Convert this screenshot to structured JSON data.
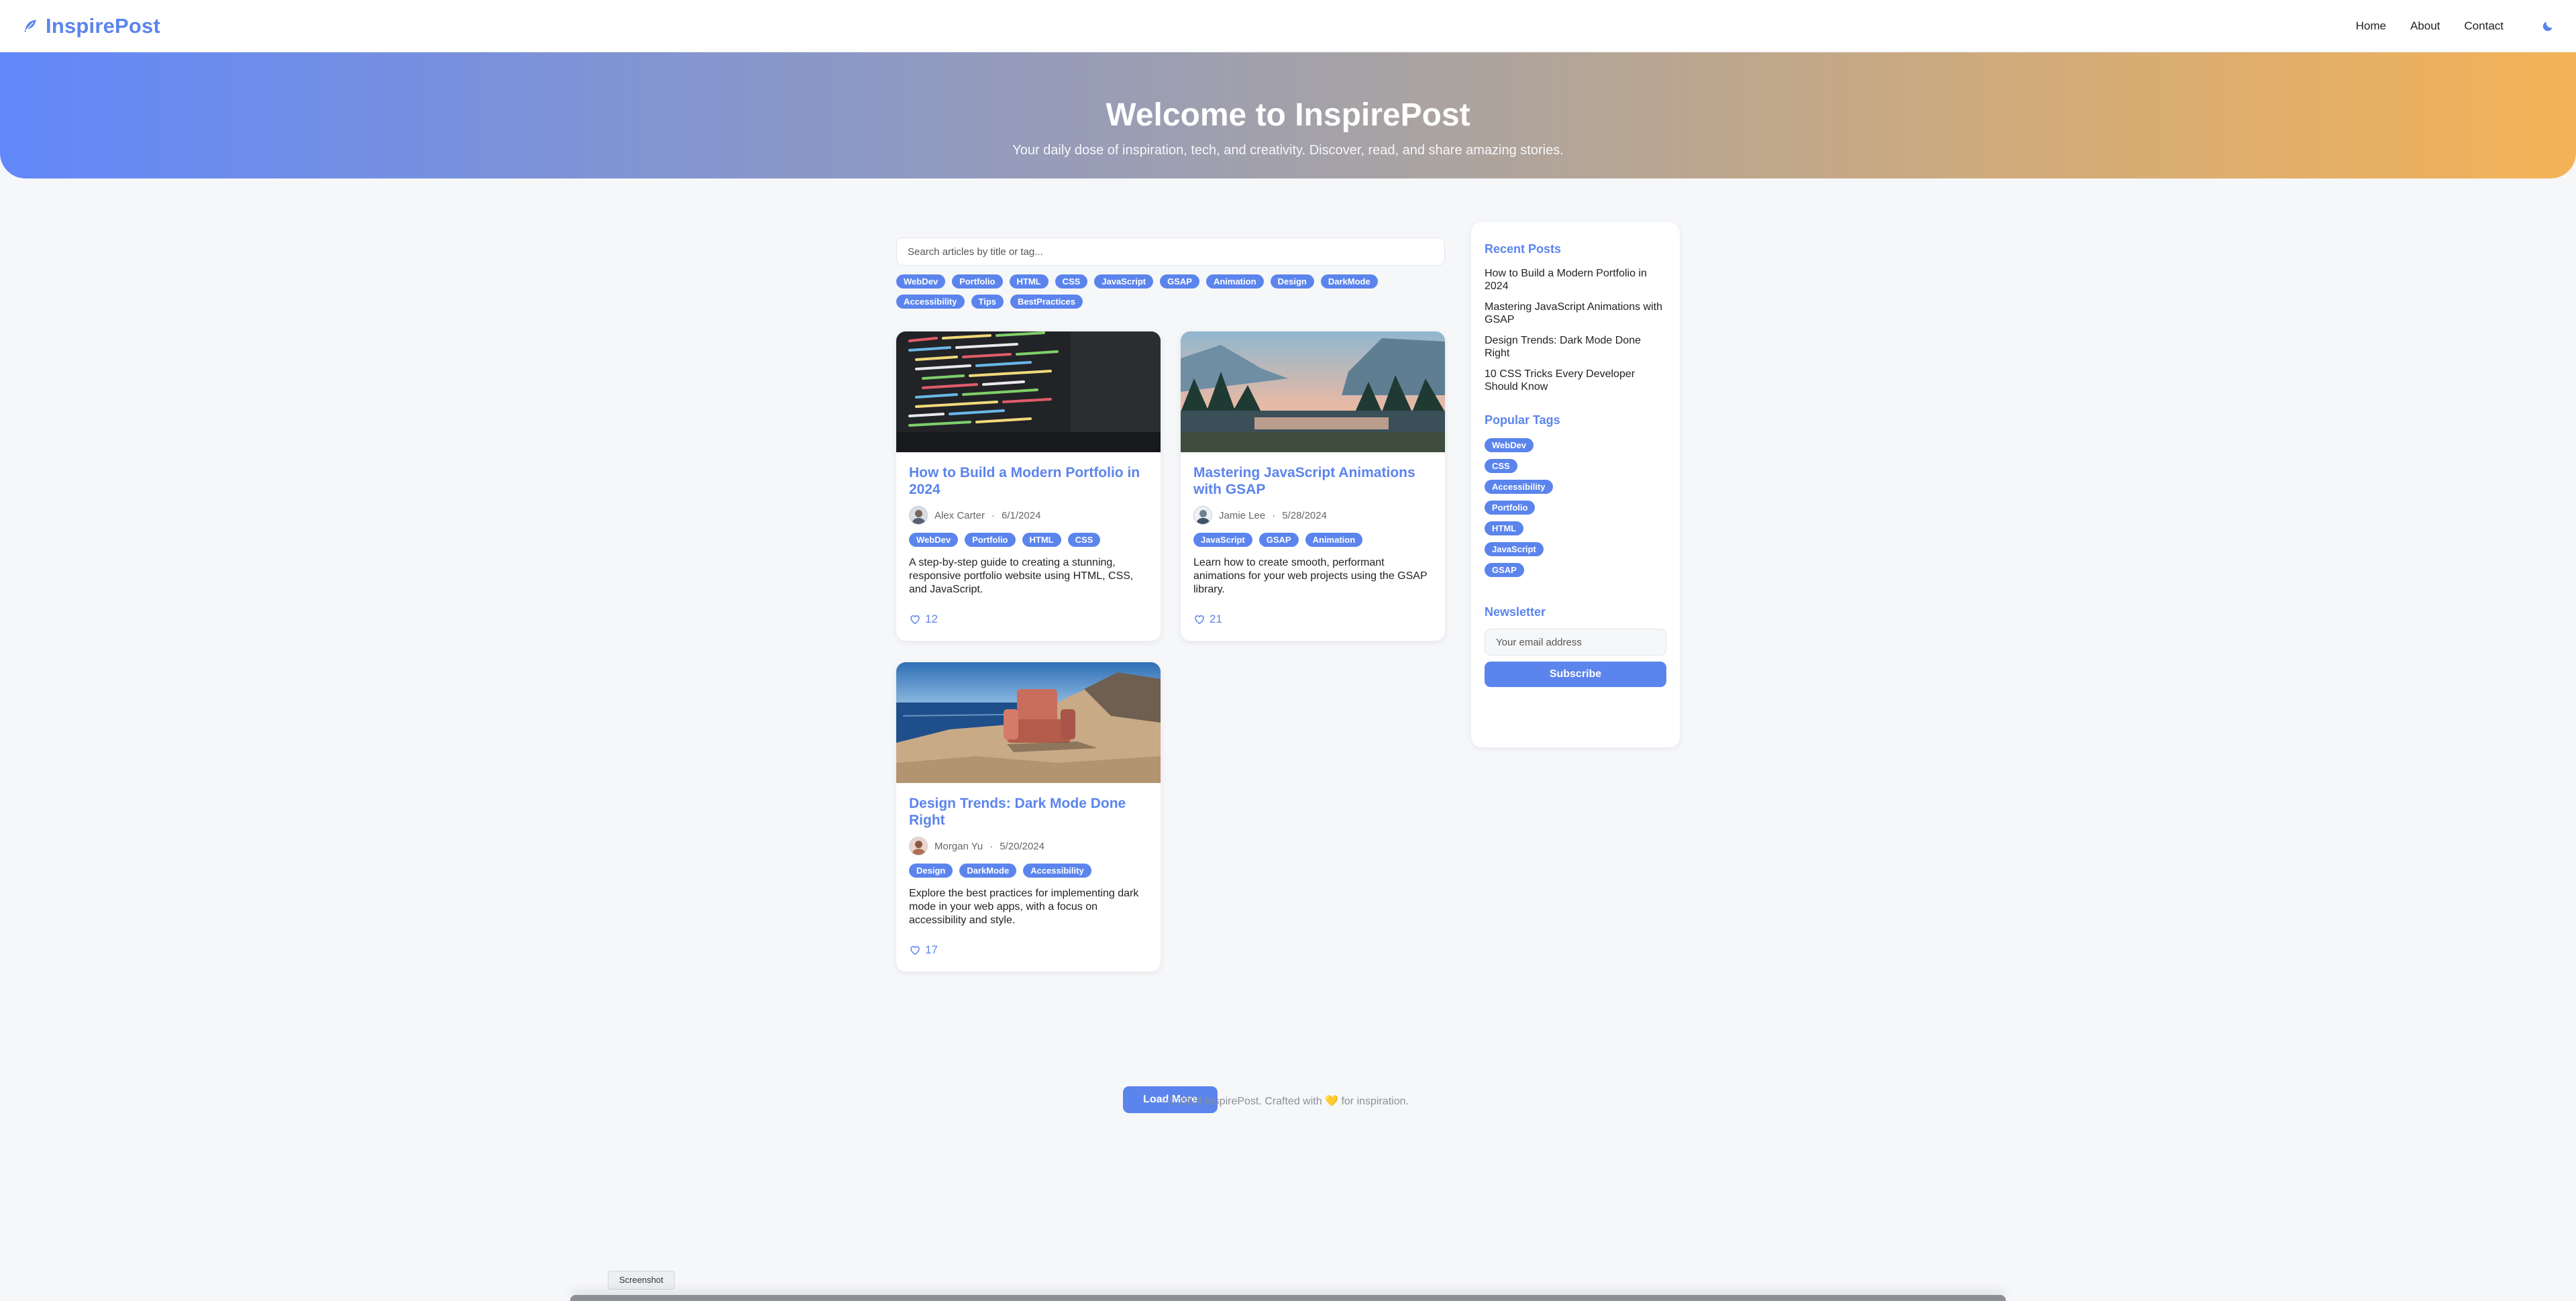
{
  "header": {
    "logo_text": "InspirePost",
    "nav": [
      "Home",
      "About",
      "Contact"
    ],
    "theme_icon": "moon-icon"
  },
  "hero": {
    "title": "Welcome to InspirePost",
    "subtitle": "Your daily dose of inspiration, tech, and creativity. Discover, read, and share amazing stories."
  },
  "search": {
    "placeholder": "Search articles by title or tag..."
  },
  "filter_tags": [
    "WebDev",
    "Portfolio",
    "HTML",
    "CSS",
    "JavaScript",
    "GSAP",
    "Animation",
    "Design",
    "DarkMode",
    "Accessibility",
    "Tips",
    "BestPractices"
  ],
  "posts": [
    {
      "title": "How to Build a Modern Portfolio in 2024",
      "author": "Alex Carter",
      "date": "6/1/2024",
      "tags": [
        "WebDev",
        "Portfolio",
        "HTML",
        "CSS"
      ],
      "excerpt": "A step-by-step guide to creating a stunning, responsive portfolio website using HTML, CSS, and JavaScript.",
      "likes": "12",
      "image": "code-screen-photo"
    },
    {
      "title": "Mastering JavaScript Animations with GSAP",
      "author": "Jamie Lee",
      "date": "5/28/2024",
      "tags": [
        "JavaScript",
        "GSAP",
        "Animation"
      ],
      "excerpt": "Learn how to create smooth, performant animations for your web projects using the GSAP library.",
      "likes": "21",
      "image": "mountain-valley-photo"
    },
    {
      "title": "Design Trends: Dark Mode Done Right",
      "author": "Morgan Yu",
      "date": "5/20/2024",
      "tags": [
        "Design",
        "DarkMode",
        "Accessibility"
      ],
      "excerpt": "Explore the best practices for implementing dark mode in your web apps, with a focus on accessibility and style.",
      "likes": "17",
      "image": "armchair-seaside-photo"
    }
  ],
  "meta_separator": "·",
  "load_more": "Load More",
  "sidebar": {
    "recent_title": "Recent Posts",
    "recent": [
      "How to Build a Modern Portfolio in 2024",
      "Mastering JavaScript Animations with GSAP",
      "Design Trends: Dark Mode Done Right",
      "10 CSS Tricks Every Developer Should Know"
    ],
    "popular_title": "Popular Tags",
    "popular_tags": [
      "WebDev",
      "CSS",
      "Accessibility",
      "Portfolio",
      "HTML",
      "JavaScript",
      "GSAP"
    ],
    "newsletter_title": "Newsletter",
    "newsletter_placeholder": "Your email address",
    "subscribe": "Subscribe"
  },
  "footer": {
    "before": "© 2024 InspirePost. Crafted with",
    "heart": "💛",
    "after": "for inspiration."
  },
  "screenshot_label": "Screenshot",
  "colors": {
    "accent": "#5b84ec",
    "hero_start": "#6188fa",
    "hero_end": "#f4b256"
  }
}
